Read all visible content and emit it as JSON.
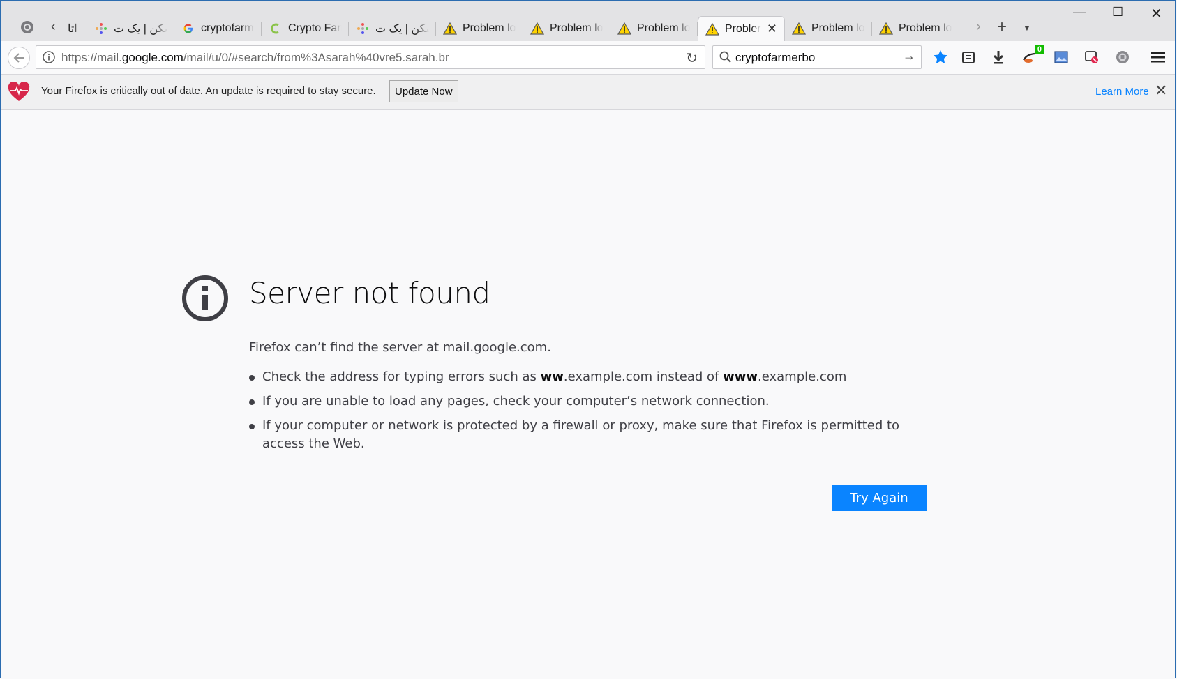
{
  "tabs": [
    {
      "label": "اتا",
      "icon": "back-arrow"
    },
    {
      "label": "شکن | یک ت",
      "icon": "colorful-dots-icon"
    },
    {
      "label": "cryptofarm",
      "icon": "google-icon"
    },
    {
      "label": "Crypto Farr",
      "icon": "crypto-farm-icon"
    },
    {
      "label": "شکن | یک ت",
      "icon": "colorful-dots-icon"
    },
    {
      "label": "Problem lo",
      "icon": "warning-icon"
    },
    {
      "label": "Problem lo",
      "icon": "warning-icon"
    },
    {
      "label": "Problem lo",
      "icon": "warning-icon"
    },
    {
      "label": "Probler",
      "icon": "warning-icon",
      "active": true
    },
    {
      "label": "Problem lo",
      "icon": "warning-icon"
    },
    {
      "label": "Problem lo",
      "icon": "warning-icon"
    }
  ],
  "navbar": {
    "url_prefix": "https://mail.",
    "url_domain": "google.com",
    "url_path": "/mail/u/0/#search/from%3Asarah%40vre5.sarah.br",
    "search_value": "cryptofarmerbo",
    "badge_count": "0"
  },
  "notification": {
    "message": "Your Firefox is critically out of date. An update is required to stay secure.",
    "update_label": "Update Now",
    "learn_more": "Learn More"
  },
  "error": {
    "title": "Server not found",
    "description": "Firefox can’t find the server at mail.google.com.",
    "item1_pre": "Check the address for typing errors such as ",
    "item1_bold1": "ww",
    "item1_mid1": ".example.com instead of ",
    "item1_bold2": "www",
    "item1_mid2": ".example.com",
    "item2": "If you are unable to load any pages, check your computer’s network connection.",
    "item3": "If your computer or network is protected by a firewall or proxy, make sure that Firefox is permitted to access the Web.",
    "try_again": "Try Again"
  },
  "colors": {
    "accent": "#0a84ff",
    "badge": "#12bc00",
    "warning": "#ffd300"
  }
}
